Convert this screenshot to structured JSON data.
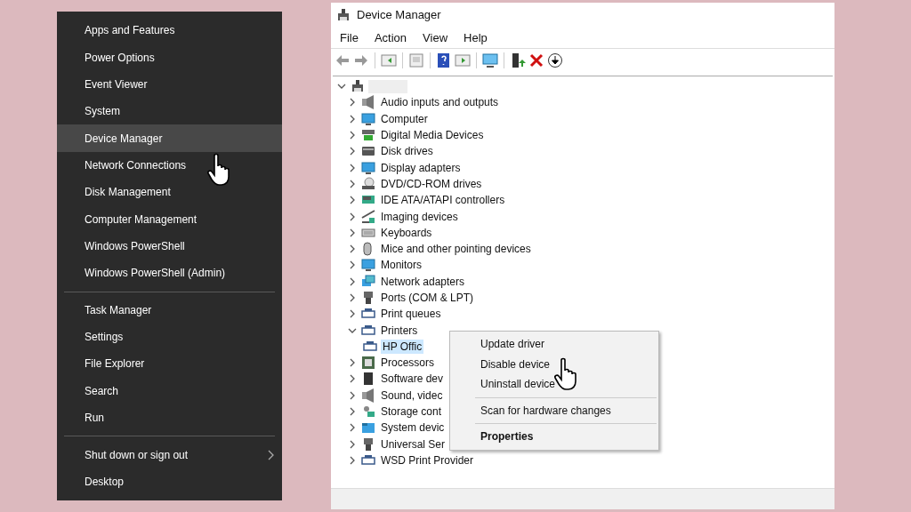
{
  "start_menu": {
    "groups": [
      [
        {
          "label": "Apps and Features",
          "selected": false,
          "kind": "item"
        },
        {
          "label": "Power Options",
          "selected": false,
          "kind": "item"
        },
        {
          "label": "Event Viewer",
          "selected": false,
          "kind": "item"
        },
        {
          "label": "System",
          "selected": false,
          "kind": "item"
        },
        {
          "label": "Device Manager",
          "selected": true,
          "kind": "item"
        },
        {
          "label": "Network Connections",
          "selected": false,
          "kind": "item"
        },
        {
          "label": "Disk Management",
          "selected": false,
          "kind": "item"
        },
        {
          "label": "Computer Management",
          "selected": false,
          "kind": "item"
        },
        {
          "label": "Windows PowerShell",
          "selected": false,
          "kind": "item"
        },
        {
          "label": "Windows PowerShell (Admin)",
          "selected": false,
          "kind": "item"
        }
      ],
      [
        {
          "label": "Task Manager",
          "selected": false,
          "kind": "item"
        },
        {
          "label": "Settings",
          "selected": false,
          "kind": "item"
        },
        {
          "label": "File Explorer",
          "selected": false,
          "kind": "item"
        },
        {
          "label": "Search",
          "selected": false,
          "kind": "item"
        },
        {
          "label": "Run",
          "selected": false,
          "kind": "item"
        }
      ],
      [
        {
          "label": "Shut down or sign out",
          "selected": false,
          "kind": "submenu"
        },
        {
          "label": "Desktop",
          "selected": false,
          "kind": "item"
        }
      ]
    ]
  },
  "device_manager": {
    "window": {
      "title": "Device Manager"
    },
    "menu": [
      "File",
      "Action",
      "View",
      "Help"
    ],
    "tree": {
      "expanded": true,
      "children": [
        {
          "label": "Audio inputs and outputs",
          "expanded": false,
          "selected": false
        },
        {
          "label": "Computer",
          "expanded": false,
          "selected": false
        },
        {
          "label": "Digital Media Devices",
          "expanded": false,
          "selected": false
        },
        {
          "label": "Disk drives",
          "expanded": false,
          "selected": false
        },
        {
          "label": "Display adapters",
          "expanded": false,
          "selected": false
        },
        {
          "label": "DVD/CD-ROM drives",
          "expanded": false,
          "selected": false
        },
        {
          "label": "IDE ATA/ATAPI controllers",
          "expanded": false,
          "selected": false
        },
        {
          "label": "Imaging devices",
          "expanded": false,
          "selected": false
        },
        {
          "label": "Keyboards",
          "expanded": false,
          "selected": false
        },
        {
          "label": "Mice and other pointing devices",
          "expanded": false,
          "selected": false
        },
        {
          "label": "Monitors",
          "expanded": false,
          "selected": false
        },
        {
          "label": "Network adapters",
          "expanded": false,
          "selected": false
        },
        {
          "label": "Ports (COM & LPT)",
          "expanded": false,
          "selected": false
        },
        {
          "label": "Print queues",
          "expanded": false,
          "selected": false
        },
        {
          "label": "Printers",
          "expanded": true,
          "selected": false,
          "children": [
            {
              "label": "HP Offic",
              "selected": true
            }
          ]
        },
        {
          "label": "Processors",
          "expanded": false,
          "selected": false
        },
        {
          "label": "Software dev",
          "expanded": false,
          "selected": false
        },
        {
          "label": "Sound, videc",
          "expanded": false,
          "selected": false
        },
        {
          "label": "Storage cont",
          "expanded": false,
          "selected": false
        },
        {
          "label": "System devic",
          "expanded": false,
          "selected": false
        },
        {
          "label": "Universal Ser",
          "expanded": false,
          "selected": false
        },
        {
          "label": "WSD Print Provider",
          "expanded": false,
          "selected": false
        }
      ]
    },
    "context_menu": [
      {
        "kind": "item",
        "label": "Update driver"
      },
      {
        "kind": "item",
        "label": "Disable device"
      },
      {
        "kind": "item",
        "label": "Uninstall device"
      },
      {
        "kind": "separator"
      },
      {
        "kind": "item",
        "label": "Scan for hardware changes"
      },
      {
        "kind": "separator"
      },
      {
        "kind": "default",
        "label": "Properties"
      }
    ]
  }
}
